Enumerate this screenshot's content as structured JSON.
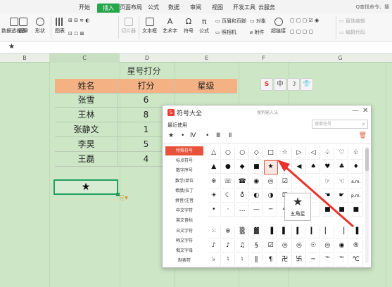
{
  "ribbon_tabs": [
    "开始",
    "插入",
    "页面布局",
    "公式",
    "数据",
    "审阅",
    "视图",
    "开发工具",
    "云服务"
  ],
  "active_tab": "插入",
  "search_hint": "Q查找命令、搜",
  "ribbon": {
    "row1": [
      "图表",
      "截屏",
      "形状",
      "图表",
      "切片器",
      "文本框",
      "艺术字",
      "符号",
      "公式",
      "页眉和页脚",
      "对象",
      "超链接",
      "窗体编辑"
    ],
    "pivot": "数据透视表",
    "screenshot": "截屏",
    "shape": "形状",
    "chart": "图表",
    "slicer": "切片器",
    "textbox": "文本框",
    "wordart": "艺术字",
    "symbol": "符号",
    "formula": "公式",
    "header_footer": "页眉和页脚",
    "camera": "照相机",
    "object": "对象",
    "attachment": "附件",
    "hyperlink": "超链接",
    "form_edit": "窗体编辑",
    "edit_code": "编辑代码"
  },
  "formula_bar": {
    "value": "★"
  },
  "columns": [
    "B",
    "C",
    "D",
    "E",
    "F",
    "G"
  ],
  "selected_column": "C",
  "table": {
    "title": "星号打分",
    "headers": [
      "姓名",
      "打分",
      "星级"
    ],
    "rows": [
      [
        "张雪",
        "6",
        ""
      ],
      [
        "王林",
        "8",
        ""
      ],
      [
        "张静文",
        "1",
        ""
      ],
      [
        "李昊",
        "5",
        ""
      ],
      [
        "王磊",
        "4",
        ""
      ]
    ]
  },
  "active_cell": "★",
  "ime_toolbar": [
    "S",
    "中",
    "☽",
    "👕"
  ],
  "dialog": {
    "title": "符号大全",
    "hint": "搜狗输入法",
    "search_placeholder": "搜索符号",
    "recent_label": "最近使用",
    "recent": [
      "★",
      "•",
      "Ⅳ",
      "•",
      "Ⅲ",
      "Ⅱ"
    ],
    "categories": [
      "特殊符号",
      "标点符号",
      "数字序号",
      "数学/单位",
      "希腊/拉丁",
      "拼音/注音",
      "中文字符",
      "英文音标",
      "日文字符",
      "韩文字符",
      "俄文字母",
      "制表符"
    ],
    "active_category": "特殊符号",
    "symbols": [
      [
        "△",
        "○",
        "○",
        "◇",
        "□",
        "☆",
        "▷",
        "◁",
        "♤",
        "♡",
        "♧"
      ],
      [
        "▲",
        "●",
        "◆",
        "■",
        "★",
        "▶",
        "◀",
        "♠",
        "♥",
        "♣",
        "♦"
      ],
      [
        "※",
        "☏",
        "☎",
        "◉",
        "◎",
        "☑",
        "",
        "",
        "☞",
        "☜",
        "a.m."
      ],
      [
        "☀",
        "☾",
        "♁",
        "◐",
        "◑",
        "☒",
        "",
        "",
        "☚",
        "☛",
        "p.m."
      ],
      [
        "•",
        "·",
        "…",
        "—",
        "─",
        "═",
        "",
        "",
        "■",
        "■",
        "■"
      ],
      [
        "⁙",
        "※",
        "▒",
        "▓",
        "▐",
        "▌",
        "▍",
        "▎",
        "▏",
        "▕",
        "▐"
      ],
      [
        "♪",
        "♪",
        "♫",
        "§",
        "☑",
        "◎",
        "◎",
        "☉",
        "◎",
        "◉",
        "®"
      ],
      [
        "♭",
        "♮",
        "♮",
        "‖",
        "¶",
        "卍",
        "卐",
        "─",
        "™",
        "™",
        "℃"
      ]
    ],
    "selected_symbol": "★",
    "tooltip_symbol": "★",
    "tooltip_name": "五角星"
  }
}
